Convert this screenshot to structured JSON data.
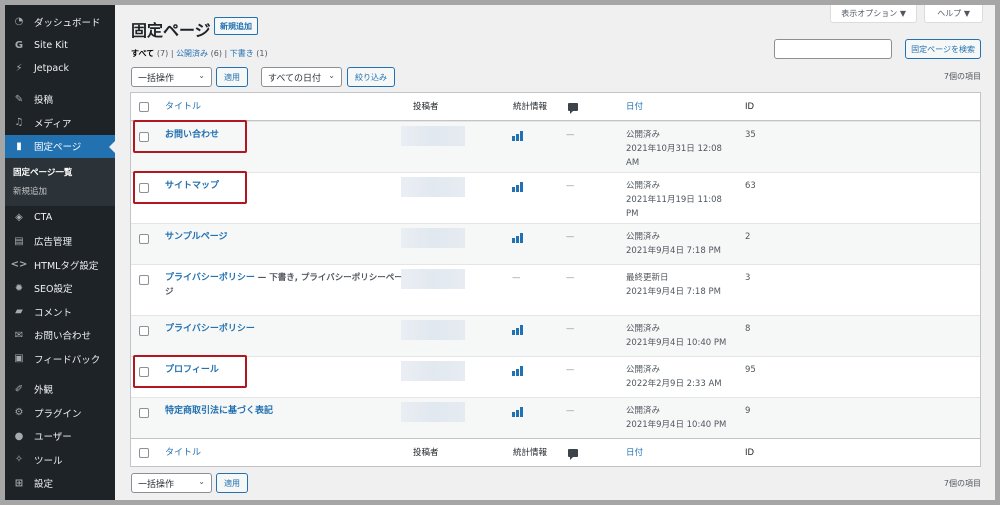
{
  "sidebar": {
    "items": [
      {
        "label": "ダッシュボード",
        "icon": "dashboard-icon",
        "glyph": "◔"
      },
      {
        "label": "Site Kit",
        "icon": "google-icon",
        "glyph": "G"
      },
      {
        "label": "Jetpack",
        "icon": "jetpack-icon",
        "glyph": "⚡"
      },
      {
        "label": "投稿",
        "icon": "posts-icon",
        "glyph": "✎"
      },
      {
        "label": "メディア",
        "icon": "media-icon",
        "glyph": "♫"
      },
      {
        "label": "固定ページ",
        "icon": "pages-icon",
        "glyph": "▮"
      },
      {
        "label": "CTA",
        "icon": "tag-icon",
        "glyph": "◈"
      },
      {
        "label": "広告管理",
        "icon": "ads-icon",
        "glyph": "▤"
      },
      {
        "label": "HTMLタグ設定",
        "icon": "code-icon",
        "glyph": "<>"
      },
      {
        "label": "SEO設定",
        "icon": "gear-icon",
        "glyph": "✹"
      },
      {
        "label": "コメント",
        "icon": "comment-icon",
        "glyph": "▰"
      },
      {
        "label": "お問い合わせ",
        "icon": "mail-icon",
        "glyph": "✉"
      },
      {
        "label": "フィードバック",
        "icon": "feedback-icon",
        "glyph": "▣"
      },
      {
        "label": "外観",
        "icon": "appearance-icon",
        "glyph": "✐"
      },
      {
        "label": "プラグイン",
        "icon": "plugin-icon",
        "glyph": "⚙"
      },
      {
        "label": "ユーザー",
        "icon": "user-icon",
        "glyph": "●"
      },
      {
        "label": "ツール",
        "icon": "wrench-icon",
        "glyph": "✧"
      },
      {
        "label": "設定",
        "icon": "settings-icon",
        "glyph": "⊞"
      }
    ],
    "submenu": [
      "固定ページ一覧",
      "新規追加"
    ]
  },
  "header": {
    "screen_options": "表示オプション ▼",
    "help": "ヘルプ ▼",
    "title": "固定ページ",
    "add_new": "新規追加"
  },
  "filters": {
    "all": "すべて",
    "all_count": "(7)",
    "published": "公開済み",
    "published_count": "(6)",
    "draft": "下書き",
    "draft_count": "(1)",
    "sep": "|"
  },
  "search": {
    "value": "",
    "button": "固定ページを検索"
  },
  "toolbar": {
    "bulk_action": "一括操作",
    "apply": "適用",
    "date_filter": "すべての日付",
    "filter": "絞り込み",
    "item_count": "7個の項目"
  },
  "table": {
    "columns": {
      "title": "タイトル",
      "author": "投稿者",
      "stats": "統計情報",
      "date": "日付",
      "id": "ID"
    },
    "rows": [
      {
        "title": "お問い合わせ",
        "state": "",
        "stats": true,
        "comments": "—",
        "status": "公開済み",
        "date": "2021年10月31日 12:08",
        "date2": "AM",
        "id": "35",
        "highlight": true
      },
      {
        "title": "サイトマップ",
        "state": "",
        "stats": true,
        "comments": "—",
        "status": "公開済み",
        "date": "2021年11月19日 11:08",
        "date2": "PM",
        "id": "63",
        "highlight": true
      },
      {
        "title": "サンプルページ",
        "state": "",
        "stats": true,
        "comments": "—",
        "status": "公開済み",
        "date": "2021年9月4日 7:18 PM",
        "date2": "",
        "id": "2",
        "highlight": false
      },
      {
        "title": "プライバシーポリシー",
        "state": " — 下書き, プライバシーポリシーページ",
        "stats": false,
        "comments": "—",
        "status": "最終更新日",
        "date": "2021年9月4日 7:18 PM",
        "date2": "",
        "id": "3",
        "highlight": false
      },
      {
        "title": "プライバシーポリシー",
        "state": "",
        "stats": true,
        "comments": "—",
        "status": "公開済み",
        "date": "2021年9月4日 10:40 PM",
        "date2": "",
        "id": "8",
        "highlight": false
      },
      {
        "title": "プロフィール",
        "state": "",
        "stats": true,
        "comments": "—",
        "status": "公開済み",
        "date": "2022年2月9日 2:33 AM",
        "date2": "",
        "id": "95",
        "highlight": true
      },
      {
        "title": "特定商取引法に基づく表記",
        "state": "",
        "stats": true,
        "comments": "—",
        "status": "公開済み",
        "date": "2021年9月4日 10:40 PM",
        "date2": "",
        "id": "9",
        "highlight": false
      }
    ],
    "no_stats": "—"
  },
  "colors": {
    "accent": "#2271b1",
    "sidebar": "#1d2327",
    "highlight": "#b0171f"
  }
}
